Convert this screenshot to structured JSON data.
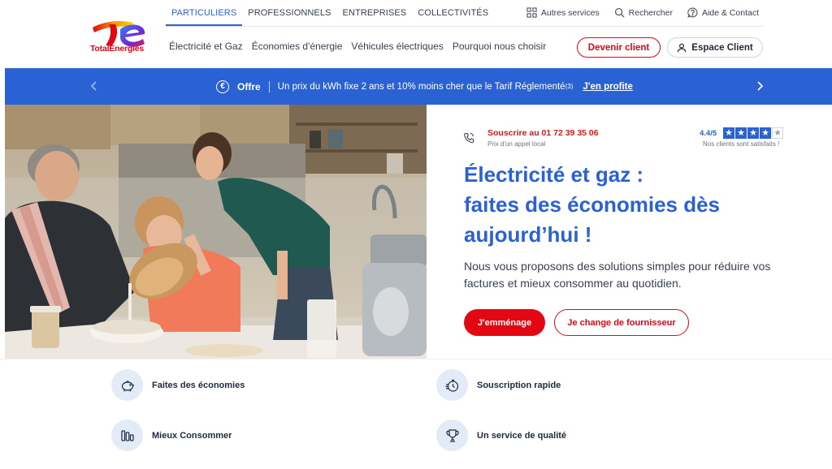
{
  "brand": {
    "name": "TotalEnergies"
  },
  "segments": [
    {
      "label": "PARTICULIERS",
      "active": true
    },
    {
      "label": "PROFESSIONNELS",
      "active": false
    },
    {
      "label": "ENTREPRISES",
      "active": false
    },
    {
      "label": "COLLECTIVITÉS",
      "active": false
    }
  ],
  "utility": {
    "services": "Autres services",
    "search": "Rechercher",
    "help": "Aide & Contact"
  },
  "main_nav": [
    "Électricité et Gaz",
    "Économies d'énergie",
    "Véhicules électriques",
    "Pourquoi nous choisir"
  ],
  "header_buttons": {
    "become_client": "Devenir client",
    "client_space": "Espace Client"
  },
  "banner": {
    "badge": "Offre",
    "text": "Un prix du kWh fixe 2 ans et 10% moins cher que le Tarif Réglementé",
    "sup": "(3)",
    "link": "J'en profite"
  },
  "hero": {
    "phone_label": "Souscrire au 01 72 39 35 06",
    "phone_sub": "Prix d'un appel local",
    "rating": "4.4/5",
    "stars_filled": 4,
    "stars_total": 5,
    "rating_sub": "Nos clients sont satisfaits !",
    "title_line1": "Électricité et gaz :",
    "title_line2": "faites des économies dès",
    "title_line3": "aujourd’hui !",
    "description": "Nous vous proposons des solutions simples pour réduire vos factures et mieux consommer au quotidien.",
    "cta_primary": "J'emménage",
    "cta_secondary": "Je change de fournisseur"
  },
  "features": [
    {
      "label": "Faites des économies",
      "icon": "piggy-bank-icon"
    },
    {
      "label": "Souscription rapide",
      "icon": "stopwatch-icon"
    },
    {
      "label": "Mieux Consommer",
      "icon": "consumption-bars-icon"
    },
    {
      "label": "Un service de qualité",
      "icon": "trophy-icon"
    }
  ],
  "colors": {
    "brand_blue": "#2a62d4",
    "brand_red": "#e30613",
    "feature_bg": "#e4ebf8"
  }
}
